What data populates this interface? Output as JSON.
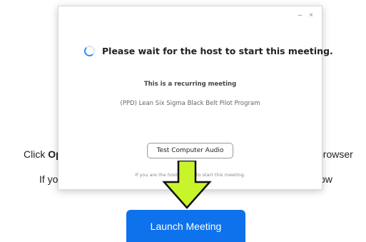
{
  "background": {
    "line1_prefix": "Click ",
    "line1_bold": "Ope",
    "line1_suffix": "browser",
    "line2_prefix": "If yo",
    "line2_suffix": "ow",
    "launch_button": "Launch Meeting",
    "launch_button_color": "#0e72ed"
  },
  "dialog": {
    "minimize": "–",
    "close": "×",
    "wait_message": "Please wait for the host to start this meeting.",
    "recurring_label": "This is a recurring meeting",
    "meeting_name": "(PPD) Lean Six Sigma Black Belt Pilot Program",
    "test_audio_button": "Test Computer Audio",
    "host_prefix": "If you are the host, p",
    "host_link": "login",
    "host_suffix": " to start this meeting.",
    "spinner_color": "#2d8cff"
  },
  "overlay": {
    "arrow_icon": "down-arrow-icon",
    "arrow_color": "#c8f52a"
  }
}
